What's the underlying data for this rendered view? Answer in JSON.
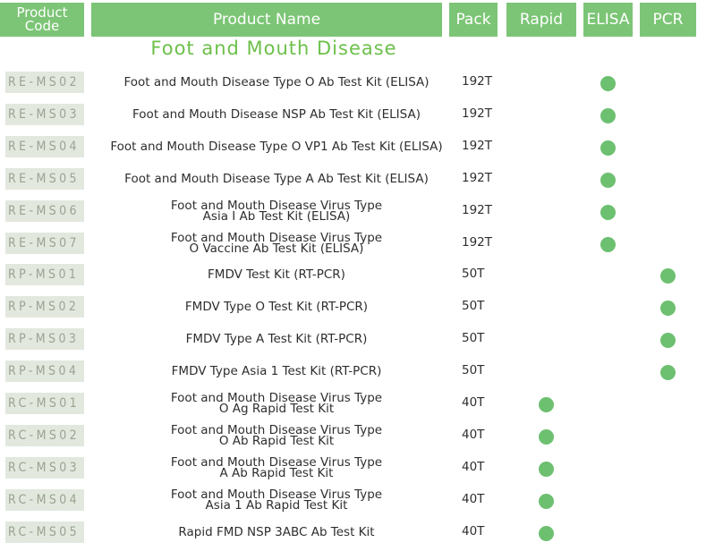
{
  "header": {
    "product_code": "Product Code",
    "product_name": "Product Name",
    "pack": "Pack",
    "rapid": "Rapid",
    "elisa": "ELISA",
    "pcr": "PCR"
  },
  "section_title": "Foot and Mouth Disease",
  "colors": {
    "header_bg": "#7cc576",
    "section_title": "#6cc04a",
    "dot": "#6cc070",
    "code_bg": "#e3e8df"
  },
  "rows": [
    {
      "code": "RE-MS02",
      "name": "Foot and Mouth Disease Type O Ab Test Kit (ELISA)",
      "pack": "192T",
      "method": "ELISA"
    },
    {
      "code": "RE-MS03",
      "name": "Foot and Mouth Disease NSP Ab Test Kit (ELISA)",
      "pack": "192T",
      "method": "ELISA"
    },
    {
      "code": "RE-MS04",
      "name": "Foot and Mouth Disease Type O VP1 Ab Test Kit (ELISA)",
      "pack": "192T",
      "method": "ELISA"
    },
    {
      "code": "RE-MS05",
      "name": "Foot and Mouth Disease Type A Ab Test Kit (ELISA)",
      "pack": "192T",
      "method": "ELISA"
    },
    {
      "code": "RE-MS06",
      "name": "Foot and Mouth Disease Virus Type\nAsia Ⅰ Ab Test Kit (ELISA)",
      "pack": "192T",
      "method": "ELISA"
    },
    {
      "code": "RE-MS07",
      "name": "Foot and Mouth Disease Virus Type\nO Vaccine Ab Test Kit (ELISA)",
      "pack": "192T",
      "method": "ELISA"
    },
    {
      "code": "RP-MS01",
      "name": "FMDV Test Kit (RT-PCR)",
      "pack": "50T",
      "method": "PCR"
    },
    {
      "code": "RP-MS02",
      "name": "FMDV Type O Test Kit (RT-PCR)",
      "pack": "50T",
      "method": "PCR"
    },
    {
      "code": "RP-MS03",
      "name": "FMDV Type A Test Kit (RT-PCR)",
      "pack": "50T",
      "method": "PCR"
    },
    {
      "code": "RP-MS04",
      "name": "FMDV Type Asia 1 Test Kit (RT-PCR)",
      "pack": "50T",
      "method": "PCR"
    },
    {
      "code": "RC-MS01",
      "name": "Foot and Mouth Disease Virus Type\nO Ag Rapid Test Kit",
      "pack": "40T",
      "method": "Rapid"
    },
    {
      "code": "RC-MS02",
      "name": "Foot and Mouth Disease Virus Type\nO Ab Rapid Test Kit",
      "pack": "40T",
      "method": "Rapid"
    },
    {
      "code": "RC-MS03",
      "name": "Foot and Mouth Disease Virus Type\nA Ab Rapid Test Kit",
      "pack": "40T",
      "method": "Rapid"
    },
    {
      "code": "RC-MS04",
      "name": "Foot and Mouth Disease Virus Type\nAsia 1 Ab Rapid Test Kit",
      "pack": "40T",
      "method": "Rapid"
    },
    {
      "code": "RC-MS05",
      "name": "Rapid FMD NSP 3ABC Ab Test Kit",
      "pack": "40T",
      "method": "Rapid"
    }
  ]
}
